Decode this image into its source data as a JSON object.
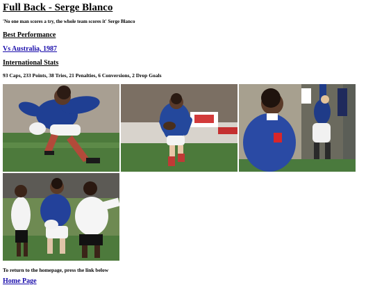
{
  "page": {
    "title": "Full Back - Serge Blanco",
    "quote": "'No one man scores a try, the whole team scores it' Serge Blanco",
    "best_performance_heading": "Best Performance",
    "best_performance_link": "Vs Australia, 1987",
    "intl_stats_heading": "International Stats",
    "intl_stats_text": "93 Caps, 233 Points, 38 Tries, 21 Penalties, 6 Conversions, 2 Drop Goals",
    "return_text": "To return to the homepage, press the link below",
    "home_link": "Home Page"
  },
  "photos": [
    {
      "name": "photo-blanco-running-1",
      "jersey": "#1f3f93"
    },
    {
      "name": "photo-blanco-ball-crowd",
      "jersey": "#24489c"
    },
    {
      "name": "photo-blanco-closeup",
      "jersey": "#2a4aa4"
    },
    {
      "name": "photo-blanco-fiji-tackle",
      "jersey": "#23419a"
    }
  ],
  "colors": {
    "link": "#1a0dab",
    "grass": "#4d7a3c",
    "france_blue": "#2145a0",
    "shorts": "#ffffff",
    "socks_red": "#c0392b"
  }
}
